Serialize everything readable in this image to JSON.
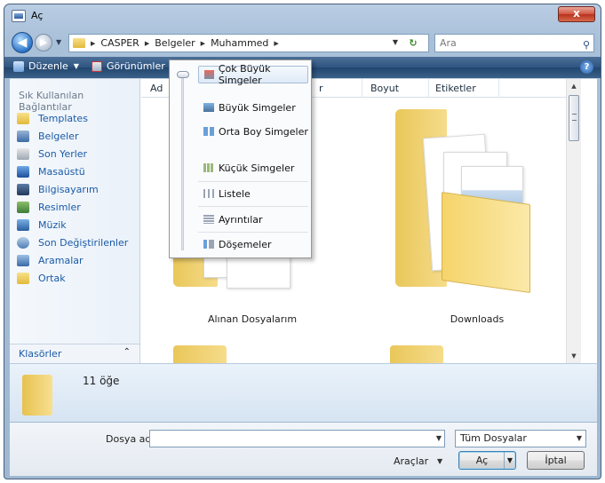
{
  "window": {
    "title": "Aç",
    "close_label": "x"
  },
  "address": {
    "crumbs": [
      "CASPER",
      "Belgeler",
      "Muhammed"
    ],
    "search_placeholder": "Ara"
  },
  "toolbar": {
    "organize": "Düzenle",
    "views": "Görünümler",
    "help": "?"
  },
  "navpane": {
    "header": "Sık Kullanılan Bağlantılar",
    "items": [
      "Templates",
      "Belgeler",
      "Son Yerler",
      "Masaüstü",
      "Bilgisayarım",
      "Resimler",
      "Müzik",
      "Son Değiştirilenler",
      "Aramalar",
      "Ortak"
    ],
    "folders_label": "Klasörler"
  },
  "columns": {
    "name": "Ad",
    "partial": "r",
    "size": "Boyut",
    "tags": "Etiketler"
  },
  "items": [
    {
      "label": "Alınan Dosyalarım"
    },
    {
      "label": "Downloads"
    }
  ],
  "views_menu": {
    "items": [
      "Çok Büyük Simgeler",
      "Büyük Simgeler",
      "Orta Boy Simgeler",
      "Küçük Simgeler",
      "Listele",
      "Ayrıntılar",
      "Döşemeler"
    ],
    "selected": "Çok Büyük Simgeler"
  },
  "details": {
    "count": "11 öğe"
  },
  "footer": {
    "filename_label": "Dosya adı:",
    "filename_value": "",
    "filetype": "Tüm Dosyalar",
    "tools": "Araçlar",
    "open": "Aç",
    "cancel": "İptal"
  },
  "colors": {
    "accent": "#1a5aa6",
    "toolbar": "#2e5580",
    "folder": "#f5d46a"
  }
}
